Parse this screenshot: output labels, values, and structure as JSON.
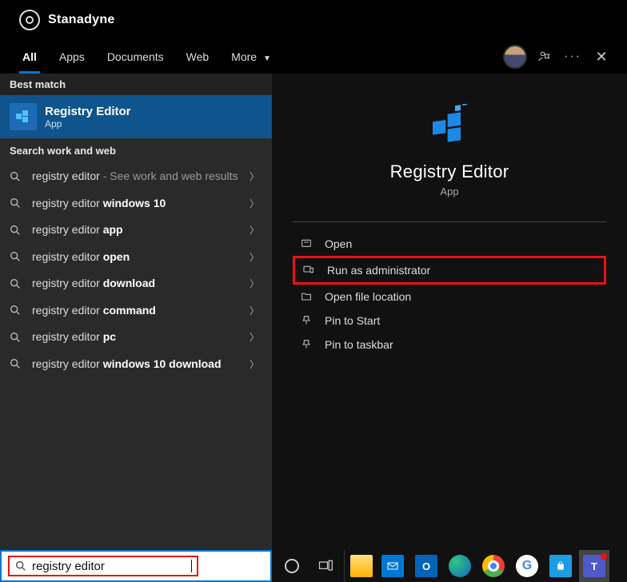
{
  "logo_text": "Stanadyne",
  "tabs": {
    "all": "All",
    "apps": "Apps",
    "documents": "Documents",
    "web": "Web",
    "more": "More"
  },
  "sections": {
    "best_match": "Best match",
    "search_web": "Search work and web"
  },
  "best_match": {
    "title": "Registry Editor",
    "subtitle": "App"
  },
  "web_items": [
    {
      "prefix": "registry editor",
      "bold": "",
      "suffix": " - See work and web results"
    },
    {
      "prefix": "registry editor ",
      "bold": "windows 10",
      "suffix": ""
    },
    {
      "prefix": "registry editor ",
      "bold": "app",
      "suffix": ""
    },
    {
      "prefix": "registry editor ",
      "bold": "open",
      "suffix": ""
    },
    {
      "prefix": "registry editor ",
      "bold": "download",
      "suffix": ""
    },
    {
      "prefix": "registry editor ",
      "bold": "command",
      "suffix": ""
    },
    {
      "prefix": "registry editor ",
      "bold": "pc",
      "suffix": ""
    },
    {
      "prefix": "registry editor ",
      "bold": "windows 10 download",
      "suffix": ""
    }
  ],
  "hero": {
    "title": "Registry Editor",
    "subtitle": "App"
  },
  "actions": {
    "open": "Open",
    "run_admin": "Run as administrator",
    "open_location": "Open file location",
    "pin_start": "Pin to Start",
    "pin_taskbar": "Pin to taskbar"
  },
  "search_box": {
    "value": "registry editor"
  },
  "taskbar_items": [
    "cortana",
    "task-view",
    "file-explorer",
    "mail",
    "outlook",
    "edge",
    "chrome",
    "google",
    "store",
    "teams"
  ]
}
